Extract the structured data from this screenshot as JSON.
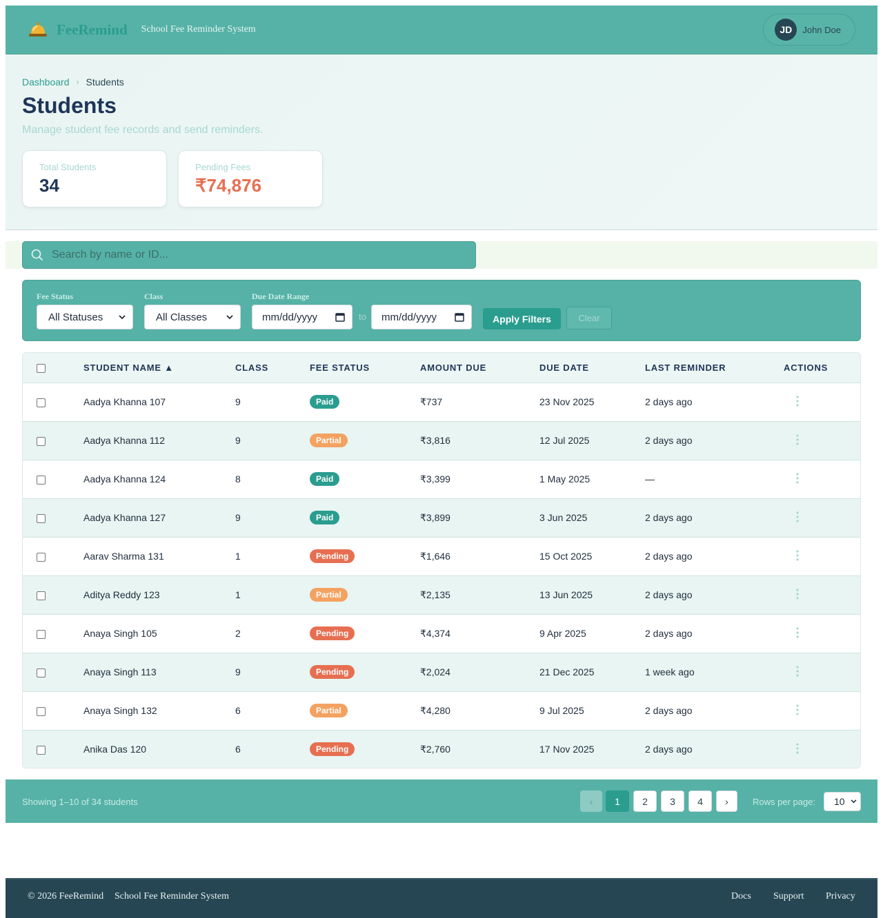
{
  "header": {
    "brand": "FeeRemind",
    "tagline": "School Fee Reminder System",
    "user_initials": "JD",
    "user_name": "John Doe"
  },
  "breadcrumb": {
    "home": "Dashboard",
    "sep": "›",
    "current": "Students"
  },
  "page": {
    "title": "Students",
    "subtitle": "Manage student fee records and send reminders."
  },
  "stats": {
    "total_label": "Total Students",
    "total_value": "34",
    "pending_label": "Pending Fees",
    "pending_value": "₹74,876"
  },
  "search": {
    "placeholder": "Search by name or ID..."
  },
  "filters": {
    "status_label": "Fee Status",
    "status_value": "All Statuses",
    "class_label": "Class",
    "class_value": "All Classes",
    "date_label": "Due Date Range",
    "date_from": "mm/dd/yyyy",
    "date_sep": "to",
    "date_to": "mm/dd/yyyy",
    "apply": "Apply Filters",
    "clear": "Clear"
  },
  "table": {
    "columns": [
      "STUDENT NAME ▲",
      "CLASS",
      "FEE STATUS",
      "AMOUNT DUE",
      "DUE DATE",
      "LAST REMINDER",
      "ACTIONS"
    ],
    "rows": [
      {
        "name": "Aadya Khanna 107",
        "class": "9",
        "status": "Paid",
        "amount": "₹737",
        "due": "23 Nov 2025",
        "last": "2 days ago"
      },
      {
        "name": "Aadya Khanna 112",
        "class": "9",
        "status": "Partial",
        "amount": "₹3,816",
        "due": "12 Jul 2025",
        "last": "2 days ago"
      },
      {
        "name": "Aadya Khanna 124",
        "class": "8",
        "status": "Paid",
        "amount": "₹3,399",
        "due": "1 May 2025",
        "last": "—"
      },
      {
        "name": "Aadya Khanna 127",
        "class": "9",
        "status": "Paid",
        "amount": "₹3,899",
        "due": "3 Jun 2025",
        "last": "2 days ago"
      },
      {
        "name": "Aarav Sharma 131",
        "class": "1",
        "status": "Pending",
        "amount": "₹1,646",
        "due": "15 Oct 2025",
        "last": "2 days ago"
      },
      {
        "name": "Aditya Reddy 123",
        "class": "1",
        "status": "Partial",
        "amount": "₹2,135",
        "due": "13 Jun 2025",
        "last": "2 days ago"
      },
      {
        "name": "Anaya Singh 105",
        "class": "2",
        "status": "Pending",
        "amount": "₹4,374",
        "due": "9 Apr 2025",
        "last": "2 days ago"
      },
      {
        "name": "Anaya Singh 113",
        "class": "9",
        "status": "Pending",
        "amount": "₹2,024",
        "due": "21 Dec 2025",
        "last": "1 week ago"
      },
      {
        "name": "Anaya Singh 132",
        "class": "6",
        "status": "Partial",
        "amount": "₹4,280",
        "due": "9 Jul 2025",
        "last": "2 days ago"
      },
      {
        "name": "Anika Das 120",
        "class": "6",
        "status": "Pending",
        "amount": "₹2,760",
        "due": "17 Nov 2025",
        "last": "2 days ago"
      }
    ]
  },
  "status_colors": {
    "Paid": "#2a9d8f",
    "Partial": "#f4a261",
    "Pending": "#e76f51"
  },
  "pagination": {
    "showing": "Showing 1–10 of 34 students",
    "prev": "‹",
    "pages": [
      "1",
      "2",
      "3",
      "4"
    ],
    "active_page": "1",
    "next": "›",
    "rows_label": "Rows per page:",
    "rows_value": "10"
  },
  "footer": {
    "copyright": "© 2026 FeeRemind",
    "system": "School Fee Reminder System",
    "links": [
      "Docs",
      "Support",
      "Privacy"
    ]
  },
  "colors": {
    "accent": "#2a9d8f",
    "header_bg": "#56b2a6",
    "title": "#1f3558",
    "pending_amount": "#e76f51",
    "footer_bg": "#264653"
  }
}
